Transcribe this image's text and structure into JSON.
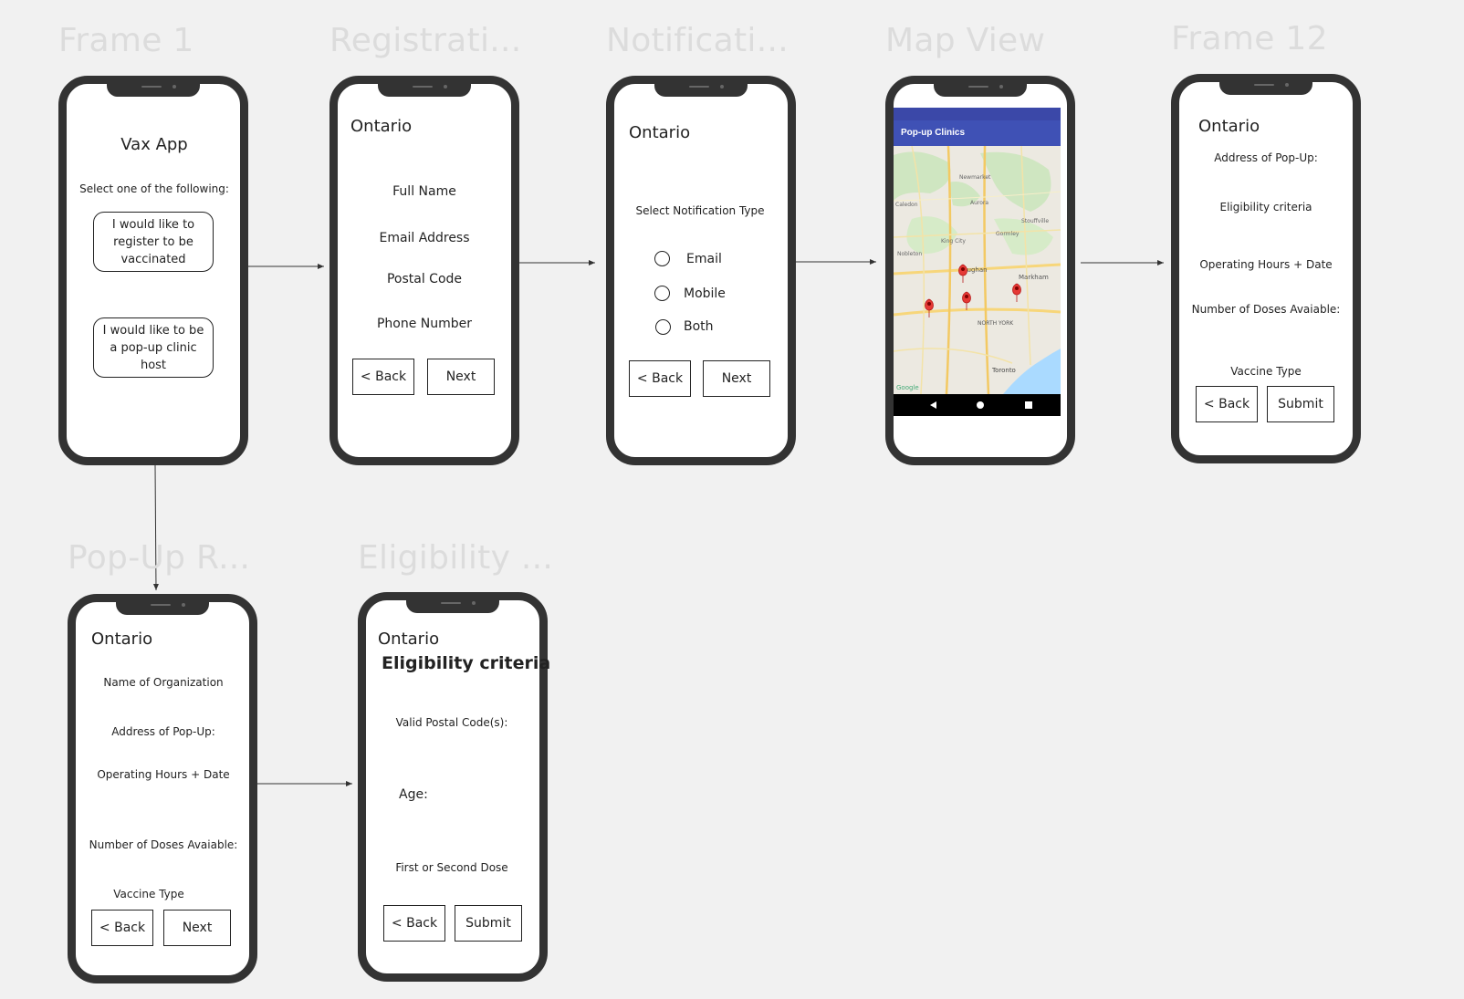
{
  "frames": {
    "frame1": {
      "title": "Frame 1",
      "app_title": "Vax App",
      "prompt": "Select one of the following:",
      "option_register": "I would like to register to be vaccinated",
      "option_host": "I would like to be a pop-up clinic host"
    },
    "registration": {
      "title": "Registrati...",
      "header": "Ontario",
      "fields": [
        "Full Name",
        "Email Address",
        "Postal Code",
        "Phone Number"
      ],
      "back_label": "< Back",
      "next_label": "Next"
    },
    "notification": {
      "title": "Notificati...",
      "header": "Ontario",
      "prompt": "Select Notification Type",
      "options": [
        "Email",
        "Mobile",
        "Both"
      ],
      "back_label": "< Back",
      "next_label": "Next"
    },
    "map": {
      "title": "Map View",
      "app_bar": "Pop-up Clinics",
      "places": [
        "Vaughan",
        "Markham",
        "NORTH YORK",
        "Toronto",
        "King City",
        "Newmarket",
        "Aurora",
        "Nobleton",
        "Caledon",
        "Gormley",
        "Stouffville"
      ],
      "attribution": "Google",
      "colors": {
        "app_bar": "#3f51b5",
        "marker": "#e53935",
        "water": "#aadaff",
        "map_bg": "#e8e8e3"
      }
    },
    "frame12": {
      "title": "Frame 12",
      "header": "Ontario",
      "fields": [
        "Address of Pop-Up:",
        "Eligibility criteria",
        "Operating Hours + Date",
        "Number of Doses Avaiable:",
        "Vaccine Type"
      ],
      "back_label": "< Back",
      "submit_label": "Submit"
    },
    "popup": {
      "title": "Pop-Up R...",
      "header": "Ontario",
      "fields": [
        "Name of Organization",
        "Address of Pop-Up:",
        "Operating Hours + Date",
        "Number of Doses Avaiable:",
        "Vaccine Type"
      ],
      "back_label": "< Back",
      "next_label": "Next"
    },
    "eligibility": {
      "title": "Eligibility ...",
      "header": "Ontario",
      "heading": "Eligibility criteria",
      "fields": [
        "Valid Postal Code(s):",
        "Age:",
        "First or Second Dose"
      ],
      "back_label": "< Back",
      "submit_label": "Submit"
    }
  }
}
